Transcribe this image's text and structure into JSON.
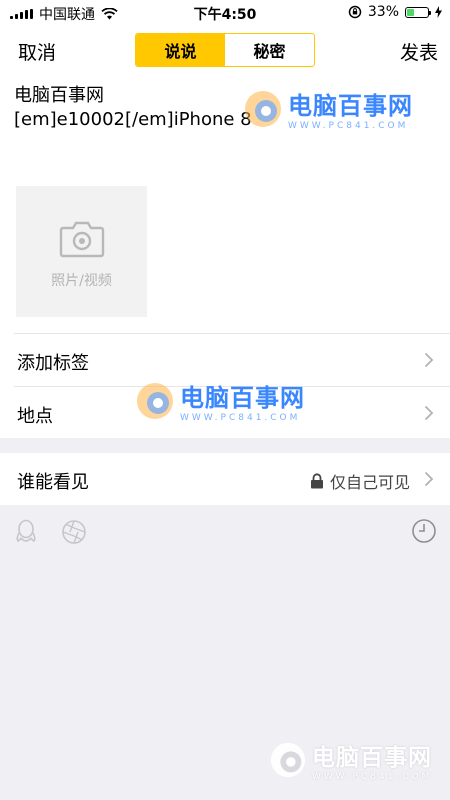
{
  "status_bar": {
    "carrier": "中国联通",
    "time": "下午4:50",
    "battery_percent": "33%",
    "battery_level": 0.33
  },
  "nav": {
    "cancel": "取消",
    "tabs": [
      "说说",
      "秘密"
    ],
    "active_tab": 0,
    "publish": "发表"
  },
  "post": {
    "line1": "电脑百事网",
    "line2": "[em]e10002[/em]iPhone 8"
  },
  "photo_picker": {
    "label": "照片/视频"
  },
  "watermark": {
    "name": "电脑百事网",
    "url": "WWW.PC841.COM"
  },
  "rows": {
    "add_tag": "添加标签",
    "location": "地点",
    "visibility_label": "谁能看见",
    "visibility_value": "仅自己可见"
  },
  "icons": {
    "camera": "camera-icon",
    "chevron": "chevron-right-icon",
    "lock": "lock-icon",
    "qq": "qq-icon",
    "shutter": "shutter-icon",
    "clock": "clock-icon"
  },
  "colors": {
    "accent": "#ffc800",
    "background": "#efeff4",
    "battery": "#4cd964"
  }
}
